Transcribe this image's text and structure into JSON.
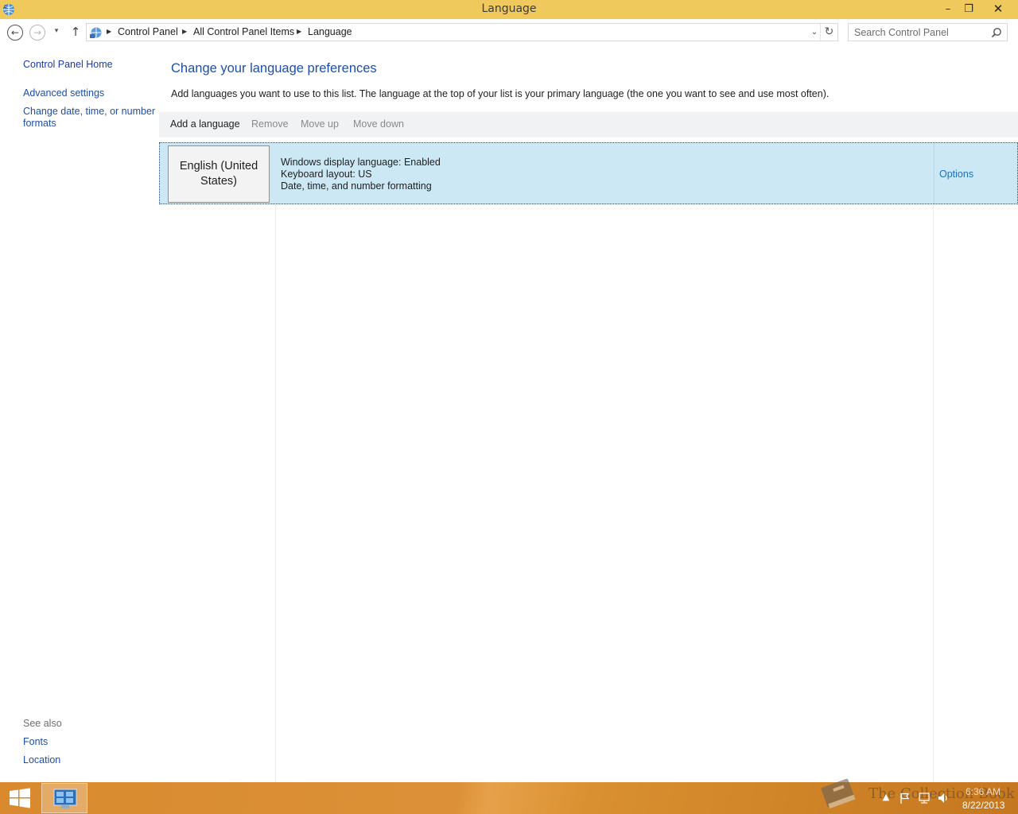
{
  "window": {
    "title": "Language",
    "minimize": "–",
    "maximize": "❐",
    "close": "✕"
  },
  "nav": {
    "back": "←",
    "forward": "→",
    "recent": "▾",
    "up": "↑"
  },
  "address": {
    "crumbs": [
      "Control Panel",
      "All Control Panel Items",
      "Language"
    ],
    "separator": "▶",
    "dropdown": "⌄",
    "refresh": "↻"
  },
  "search": {
    "placeholder": "Search Control Panel"
  },
  "sidebar": {
    "home": "Control Panel Home",
    "advanced": "Advanced settings",
    "date_formats": "Change date, time, or number formats",
    "see_also": "See also",
    "fonts": "Fonts",
    "location": "Location"
  },
  "main": {
    "title": "Change your language preferences",
    "description": "Add languages you want to use to this list. The language at the top of your list is your primary language (the one you want to see and use most often).",
    "toolbar": {
      "add": "Add a language",
      "remove": "Remove",
      "move_up": "Move up",
      "move_down": "Move down"
    },
    "languages": [
      {
        "name": "English (United States)",
        "details": [
          "Windows display language: Enabled",
          "Keyboard layout: US",
          "Date, time, and number formatting"
        ],
        "options": "Options"
      }
    ]
  },
  "taskbar": {
    "watermark": "The Collection Book",
    "clock_time": "6:36 AM",
    "clock_date": "8/22/2013",
    "tray_up": "▲"
  },
  "colors": {
    "titlebar": "#f0c95c",
    "link": "#1e4fa6",
    "selection": "#cde8f5",
    "taskbar": "#d98a2e"
  }
}
